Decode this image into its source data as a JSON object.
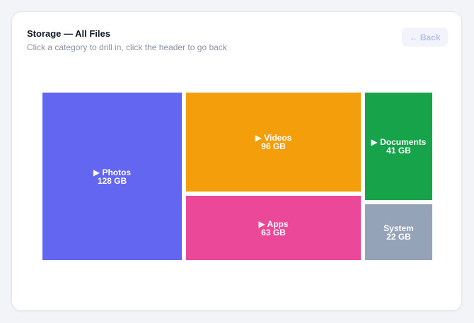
{
  "header": {
    "title": "Storage — All Files",
    "subtitle": "Click a category to drill in, click the header to go back",
    "back_label": "← Back"
  },
  "treemap": {
    "tiles": [
      {
        "name": "▶ Photos",
        "size": "128 GB",
        "value_gb": 128,
        "color": "#6366f1"
      },
      {
        "name": "▶ Videos",
        "size": "96 GB",
        "value_gb": 96,
        "color": "#f59e0b"
      },
      {
        "name": "▶ Apps",
        "size": "63 GB",
        "value_gb": 63,
        "color": "#ec4899"
      },
      {
        "name": "▶ Documents",
        "size": "41 GB",
        "value_gb": 41,
        "color": "#16a34a"
      },
      {
        "name": "System",
        "size": "22 GB",
        "value_gb": 22,
        "color": "#94a3b8"
      }
    ]
  }
}
